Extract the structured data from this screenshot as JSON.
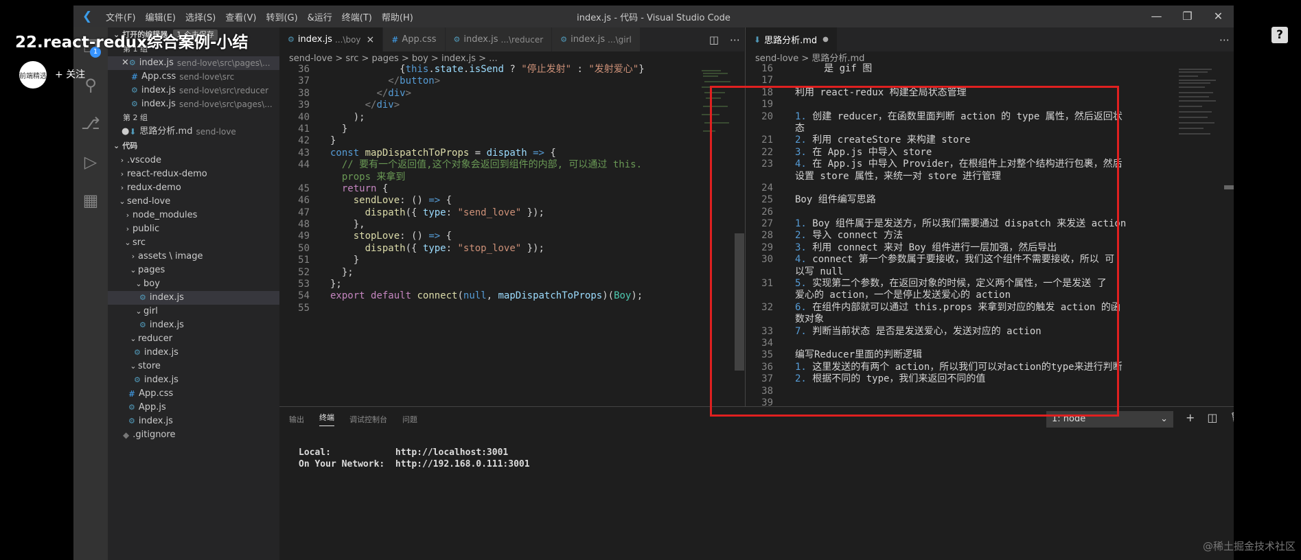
{
  "overlay": {
    "video_title": "22.react-redux综合案例-小结",
    "follow_label": "+ 关注",
    "avatar_text": "前端精选",
    "help_glyph": "?",
    "watermark": "@稀土掘金技术社区"
  },
  "titlebar": {
    "menus": [
      "文件(F)",
      "编辑(E)",
      "选择(S)",
      "查看(V)",
      "转到(G)",
      "&运行",
      "终端(T)",
      "帮助(H)"
    ],
    "window_title": "index.js - 代码 - Visual Studio Code"
  },
  "activity": {
    "badge": "1"
  },
  "sidebar": {
    "open_editors_label": "打开的编辑器",
    "unsaved_badge": "1 个未保存",
    "group1_label": "第 1 组",
    "group2_label": "第 2 组",
    "open_editors_g1": [
      {
        "name": "index.js",
        "desc": "send-love\\src\\pages\\..."
      },
      {
        "name": "App.css",
        "desc": "send-love\\src"
      },
      {
        "name": "index.js",
        "desc": "send-love\\src\\reducer"
      },
      {
        "name": "index.js",
        "desc": "send-love\\src\\pages\\..."
      }
    ],
    "open_editors_g2": [
      {
        "name": "思路分析.md",
        "desc": "send-love"
      }
    ],
    "workspace_label": "代码",
    "tree": [
      {
        "name": ".vscode",
        "indent": 1,
        "kind": "folder-closed"
      },
      {
        "name": "react-redux-demo",
        "indent": 1,
        "kind": "folder-closed"
      },
      {
        "name": "redux-demo",
        "indent": 1,
        "kind": "folder-closed"
      },
      {
        "name": "send-love",
        "indent": 1,
        "kind": "folder-open"
      },
      {
        "name": "node_modules",
        "indent": 2,
        "kind": "folder-closed"
      },
      {
        "name": "public",
        "indent": 2,
        "kind": "folder-closed"
      },
      {
        "name": "src",
        "indent": 2,
        "kind": "folder-open"
      },
      {
        "name": "assets \\ image",
        "indent": 3,
        "kind": "folder-closed"
      },
      {
        "name": "pages",
        "indent": 3,
        "kind": "folder-open"
      },
      {
        "name": "boy",
        "indent": 4,
        "kind": "folder-open"
      },
      {
        "name": "index.js",
        "indent": 5,
        "kind": "js",
        "selected": true
      },
      {
        "name": "girl",
        "indent": 4,
        "kind": "folder-open"
      },
      {
        "name": "index.js",
        "indent": 5,
        "kind": "js"
      },
      {
        "name": "reducer",
        "indent": 3,
        "kind": "folder-open"
      },
      {
        "name": "index.js",
        "indent": 4,
        "kind": "js"
      },
      {
        "name": "store",
        "indent": 3,
        "kind": "folder-open"
      },
      {
        "name": "index.js",
        "indent": 4,
        "kind": "js"
      },
      {
        "name": "App.css",
        "indent": 3,
        "kind": "css"
      },
      {
        "name": "App.js",
        "indent": 3,
        "kind": "js"
      },
      {
        "name": "index.js",
        "indent": 3,
        "kind": "js"
      },
      {
        "name": ".gitignore",
        "indent": 2,
        "kind": "git"
      }
    ]
  },
  "editor_left": {
    "tabs": [
      {
        "name": "index.js",
        "desc": "...\\boy",
        "icon": "js",
        "active": true,
        "close": "×"
      },
      {
        "name": "App.css",
        "desc": "",
        "icon": "css"
      },
      {
        "name": "index.js",
        "desc": "...\\reducer",
        "icon": "js"
      },
      {
        "name": "index.js",
        "desc": "...\\girl",
        "icon": "js"
      }
    ],
    "breadcrumb": "send-love  >  src  >  pages  >  boy  >  index.js  >  ...",
    "lines": [
      {
        "n": "36",
        "html": "            <span class=\"p\">{</span><span class=\"k\">this</span><span class=\"p\">.</span><span class=\"v\">state</span><span class=\"p\">.</span><span class=\"v\">isSend</span><span class=\"p\"> ? </span><span class=\"s\">\"停止发射\"</span><span class=\"p\"> : </span><span class=\"s\">\"发射爱心\"</span><span class=\"p\">}</span>"
      },
      {
        "n": "37",
        "html": "          <span class=\"t\">&lt;/</span><span class=\"k\">button</span><span class=\"t\">&gt;</span>"
      },
      {
        "n": "38",
        "html": "        <span class=\"t\">&lt;/</span><span class=\"k\">div</span><span class=\"t\">&gt;</span>"
      },
      {
        "n": "39",
        "html": "      <span class=\"t\">&lt;/</span><span class=\"k\">div</span><span class=\"t\">&gt;</span>"
      },
      {
        "n": "40",
        "html": "    <span class=\"p\">);</span>"
      },
      {
        "n": "41",
        "html": "  <span class=\"p\">}</span>"
      },
      {
        "n": "42",
        "html": "<span class=\"p\">}</span>"
      },
      {
        "n": "43",
        "html": "<span class=\"k\">const</span> <span class=\"f\">mapDispatchToProps</span> <span class=\"p\">=</span> <span class=\"v\">dispath</span> <span class=\"k\">=&gt;</span> <span class=\"p\">{</span>"
      },
      {
        "n": "44",
        "html": "  <span class=\"c\">// 要有一个返回值,这个对象会返回到组件的内部, 可以通过 this.</span>"
      },
      {
        "n": "",
        "html": "  <span class=\"c\">props 来拿到</span>"
      },
      {
        "n": "45",
        "html": "  <span class=\"kf\">return</span> <span class=\"p\">{</span>"
      },
      {
        "n": "46",
        "html": "    <span class=\"f\">sendLove</span><span class=\"p\">: () </span><span class=\"k\">=&gt;</span><span class=\"p\"> {</span>"
      },
      {
        "n": "47",
        "html": "      <span class=\"f\">dispath</span><span class=\"p\">({ </span><span class=\"v\">type</span><span class=\"p\">: </span><span class=\"s\">\"send_love\"</span><span class=\"p\"> });</span>"
      },
      {
        "n": "48",
        "html": "    <span class=\"p\">},</span>"
      },
      {
        "n": "49",
        "html": "    <span class=\"f\">stopLove</span><span class=\"p\">: () </span><span class=\"k\">=&gt;</span><span class=\"p\"> {</span>"
      },
      {
        "n": "50",
        "html": "      <span class=\"f\">dispath</span><span class=\"p\">({ </span><span class=\"v\">type</span><span class=\"p\">: </span><span class=\"s\">\"stop_love\"</span><span class=\"p\"> });</span>"
      },
      {
        "n": "51",
        "html": "    <span class=\"p\">}</span>"
      },
      {
        "n": "52",
        "html": "  <span class=\"p\">};</span>"
      },
      {
        "n": "53",
        "html": "<span class=\"p\">};</span>"
      },
      {
        "n": "54",
        "html": "<span class=\"kf\">export</span> <span class=\"kf\">default</span> <span class=\"f\">connect</span><span class=\"p\">(</span><span class=\"k\">null</span><span class=\"p\">, </span><span class=\"v\">mapDispatchToProps</span><span class=\"p\">)(</span><span class=\"cl\">Boy</span><span class=\"p\">);</span>"
      },
      {
        "n": "55",
        "html": ""
      }
    ]
  },
  "editor_right": {
    "tab": {
      "name": "思路分析.md",
      "dirty": "●"
    },
    "breadcrumb": "send-love  >  思路分析.md",
    "lines": [
      {
        "n": "16",
        "text": "     是 gif 图"
      },
      {
        "n": "17",
        "text": ""
      },
      {
        "n": "18",
        "text": "利用 react-redux 构建全局状态管理"
      },
      {
        "n": "19",
        "text": ""
      },
      {
        "n": "20",
        "num": "1.",
        "text": " 创建 reducer，在函数里面判断 action 的 type 属性，然后返回状"
      },
      {
        "n": "",
        "text": "态"
      },
      {
        "n": "21",
        "num": "2.",
        "text": " 利用 createStore 来构建 store"
      },
      {
        "n": "22",
        "num": "3.",
        "text": " 在 App.js 中导入 store"
      },
      {
        "n": "23",
        "num": "4.",
        "text": " 在 App.js 中导入 Provider，在根组件上对整个结构进行包裹，然后"
      },
      {
        "n": "",
        "text": "设置 store 属性，来统一对 store 进行管理"
      },
      {
        "n": "24",
        "text": ""
      },
      {
        "n": "25",
        "text": "Boy 组件编写思路"
      },
      {
        "n": "26",
        "text": ""
      },
      {
        "n": "27",
        "num": "1.",
        "text": " Boy 组件属于是发送方，所以我们需要通过 dispatch 来发送 action"
      },
      {
        "n": "28",
        "num": "2.",
        "text": " 导入 connect 方法"
      },
      {
        "n": "29",
        "num": "3.",
        "text": " 利用 connect 来对 Boy 组件进行一层加强，然后导出"
      },
      {
        "n": "30",
        "num": "4.",
        "text": " connect 第一个参数属于要接收，我们这个组件不需要接收，所以 可"
      },
      {
        "n": "",
        "text": "以写 null"
      },
      {
        "n": "31",
        "num": "5.",
        "text": " 实现第二个参数，在返回对象的时候，定义两个属性，一个是发送 了"
      },
      {
        "n": "",
        "text": "爱心的 action，一个是停止发送爱心的 action"
      },
      {
        "n": "32",
        "num": "6.",
        "text": " 在组件内部就可以通过 this.props 来拿到对应的触发 action 的函"
      },
      {
        "n": "",
        "text": "数对象"
      },
      {
        "n": "33",
        "num": "7.",
        "text": " 判断当前状态 是否是发送爱心，发送对应的 action"
      },
      {
        "n": "34",
        "text": ""
      },
      {
        "n": "35",
        "text": "编写Reducer里面的判断逻辑"
      },
      {
        "n": "36",
        "num": "1.",
        "text": " 这里发送的有两个 action，所以我们可以对action的type来进行判断"
      },
      {
        "n": "37",
        "num": "2.",
        "text": " 根据不同的 type，我们来返回不同的值"
      },
      {
        "n": "38",
        "text": ""
      },
      {
        "n": "39",
        "text": ""
      }
    ]
  },
  "panel": {
    "tabs": [
      "输出",
      "终端",
      "调试控制台",
      "问题"
    ],
    "active_tab": "终端",
    "terminal_select": "1: node",
    "terminal_lines": [
      "",
      "Local:            http://localhost:3001",
      "On Your Network:  http://192.168.0.111:3001"
    ]
  }
}
